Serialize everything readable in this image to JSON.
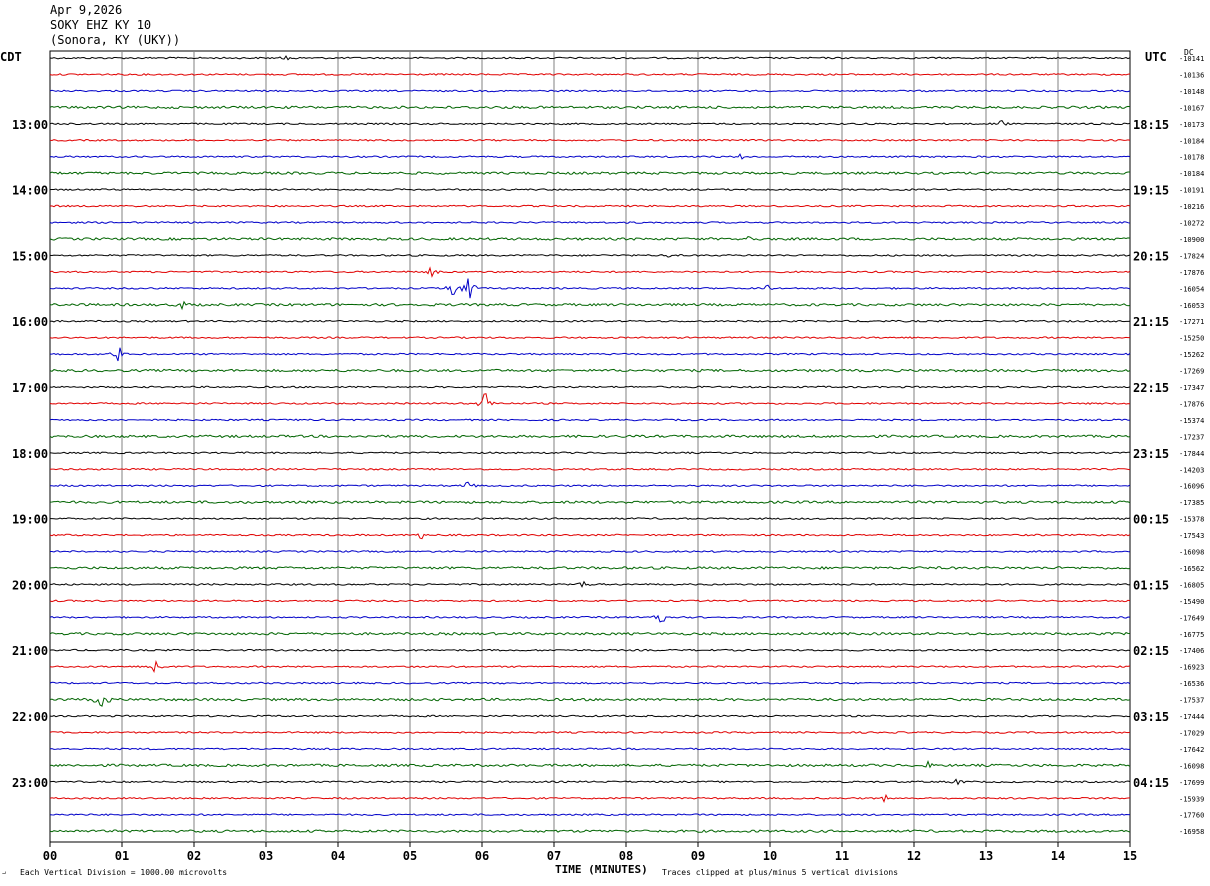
{
  "header": {
    "date": "Apr 9,2026",
    "station": "SOKY EHZ KY 10",
    "location": "(Sonora, KY (UKY))"
  },
  "left_tz": "CDT",
  "right_tz": "UTC",
  "dc_label": "DC",
  "footer": {
    "scale_note": "Each Vertical Division = 1000.00 microvolts",
    "clip_note": "Traces clipped at plus/minus 5 vertical divisions",
    "xlabel": "TIME (MINUTES)"
  },
  "colors": {
    "trace_cycle": [
      "#000000",
      "#e00000",
      "#0000c8",
      "#006400"
    ],
    "grid": "#808080"
  },
  "chart_data": {
    "type": "line",
    "title": "SOKY EHZ KY 10",
    "xlabel": "TIME (MINUTES)",
    "xlim": [
      0,
      15
    ],
    "x_ticks": [
      "00",
      "01",
      "02",
      "03",
      "04",
      "05",
      "06",
      "07",
      "08",
      "09",
      "10",
      "11",
      "12",
      "13",
      "14",
      "15"
    ],
    "left_time_labels": [
      "13:00",
      "14:00",
      "15:00",
      "16:00",
      "17:00",
      "18:00",
      "19:00",
      "20:00",
      "21:00",
      "22:00",
      "23:00"
    ],
    "right_time_labels": [
      "18:15",
      "19:15",
      "20:15",
      "21:15",
      "22:15",
      "23:15",
      "00:15",
      "01:15",
      "02:15",
      "03:15",
      "04:15"
    ],
    "dc_offsets": [
      "-10141",
      "-10136",
      "-10148",
      "-10167",
      "-10173",
      "-10184",
      "-10178",
      "-10184",
      "-10191",
      "-10216",
      "-10272",
      "-10900",
      "-17824",
      "-17876",
      "-16054",
      "-16053",
      "-17271",
      "-15250",
      "-15262",
      "-17269",
      "-17347",
      "-17876",
      "-15374",
      "-17237",
      "-17844",
      "-14203",
      "-16096",
      "-17385",
      "-15378",
      "-17543",
      "-16098",
      "-16562",
      "-16805",
      "-15490",
      "-17649",
      "-16775",
      "-17406",
      "-16923",
      "-16536",
      "-17537",
      "-17444",
      "-17029",
      "-17642",
      "-16098",
      "-17699",
      "-15939",
      "-17760",
      "-16958"
    ],
    "events": [
      {
        "row": 0,
        "minute": 3.3,
        "amp": 2
      },
      {
        "row": 4,
        "minute": 13.2,
        "amp": 3
      },
      {
        "row": 6,
        "minute": 9.6,
        "amp": 3
      },
      {
        "row": 11,
        "minute": 9.7,
        "amp": 2
      },
      {
        "row": 12,
        "minute": 8.6,
        "amp": 2
      },
      {
        "row": 13,
        "minute": 5.3,
        "amp": 4
      },
      {
        "row": 14,
        "minute": 5.82,
        "amp": 10
      },
      {
        "row": 14,
        "minute": 5.6,
        "amp": 6
      },
      {
        "row": 14,
        "minute": 9.95,
        "amp": 3
      },
      {
        "row": 15,
        "minute": 1.85,
        "amp": 4
      },
      {
        "row": 18,
        "minute": 0.95,
        "amp": 7
      },
      {
        "row": 21,
        "minute": 6.05,
        "amp": 9
      },
      {
        "row": 26,
        "minute": 5.8,
        "amp": 3
      },
      {
        "row": 29,
        "minute": 5.15,
        "amp": 3
      },
      {
        "row": 32,
        "minute": 7.4,
        "amp": 3
      },
      {
        "row": 34,
        "minute": 8.5,
        "amp": 4
      },
      {
        "row": 37,
        "minute": 1.45,
        "amp": 5
      },
      {
        "row": 39,
        "minute": 0.72,
        "amp": 6
      },
      {
        "row": 43,
        "minute": 12.2,
        "amp": 3
      },
      {
        "row": 44,
        "minute": 12.6,
        "amp": 3
      },
      {
        "row": 45,
        "minute": 11.6,
        "amp": 3
      }
    ]
  }
}
